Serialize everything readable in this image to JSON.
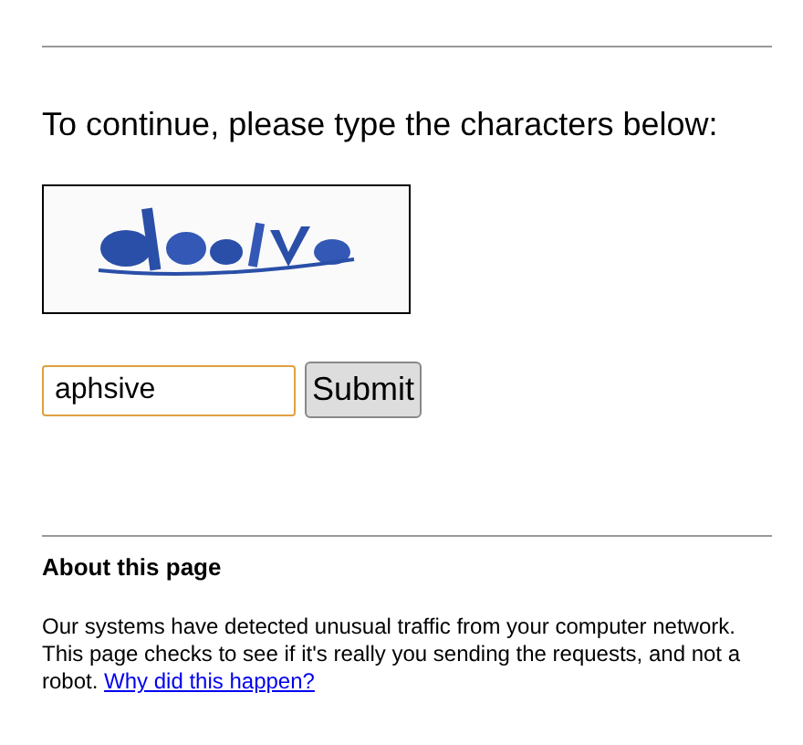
{
  "heading": "To continue, please type the characters below:",
  "answer": {
    "value": "aphsive"
  },
  "submit": {
    "label": "Submit"
  },
  "about": {
    "title": "About this page",
    "text": "Our systems have detected unusual traffic from your computer network. This page checks to see if it's really you sending the requests, and not a robot.",
    "link": "Why did this happen?"
  }
}
